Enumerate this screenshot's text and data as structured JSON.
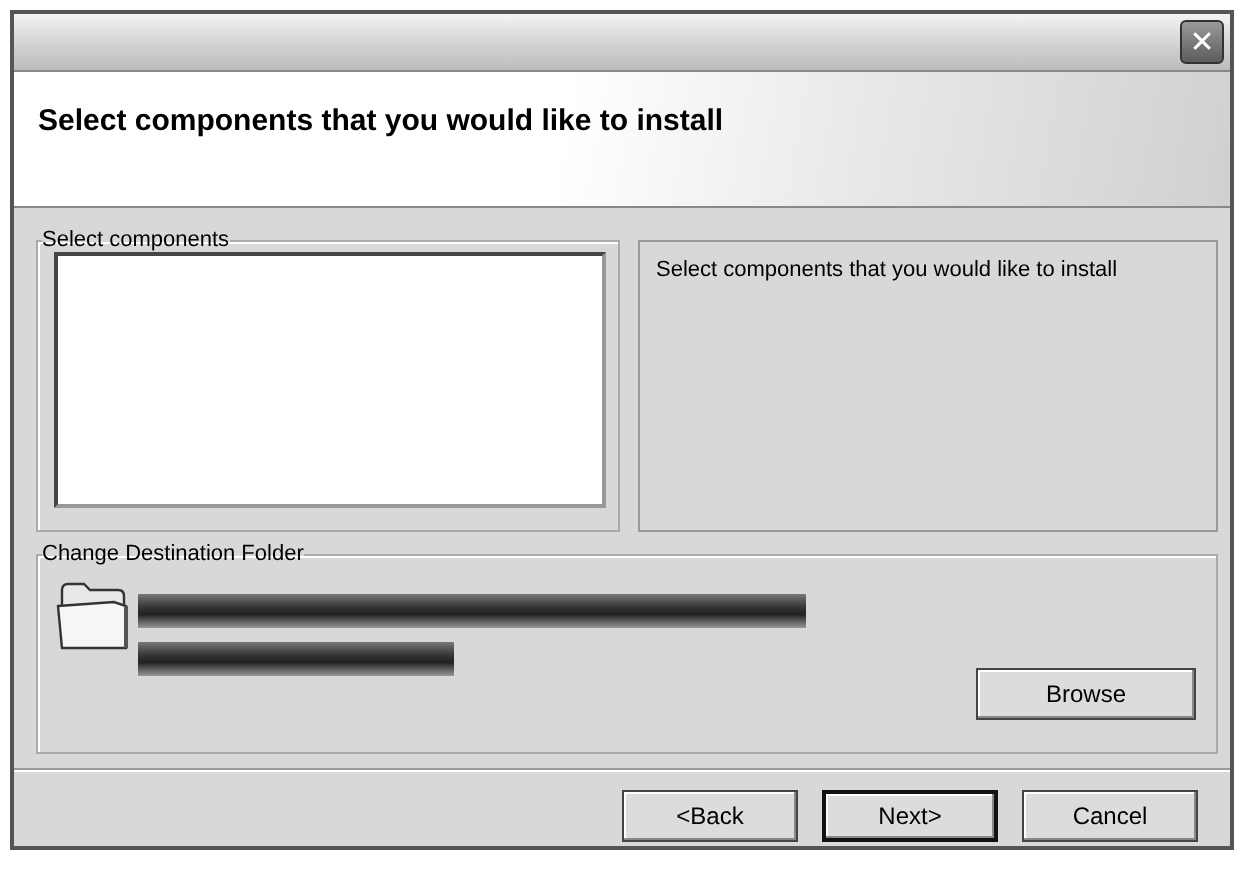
{
  "window": {
    "close": "✕"
  },
  "header": {
    "title": "Select components that you would like to install"
  },
  "components": {
    "legend": "Select components"
  },
  "description": {
    "text": "Select components that you would like to install"
  },
  "destination": {
    "legend": "Change Destination Folder",
    "browse": "Browse"
  },
  "buttons": [
    {
      "label": "<Back",
      "default": false
    },
    {
      "label": "Next>",
      "default": true
    },
    {
      "label": "Cancel",
      "default": false
    }
  ]
}
